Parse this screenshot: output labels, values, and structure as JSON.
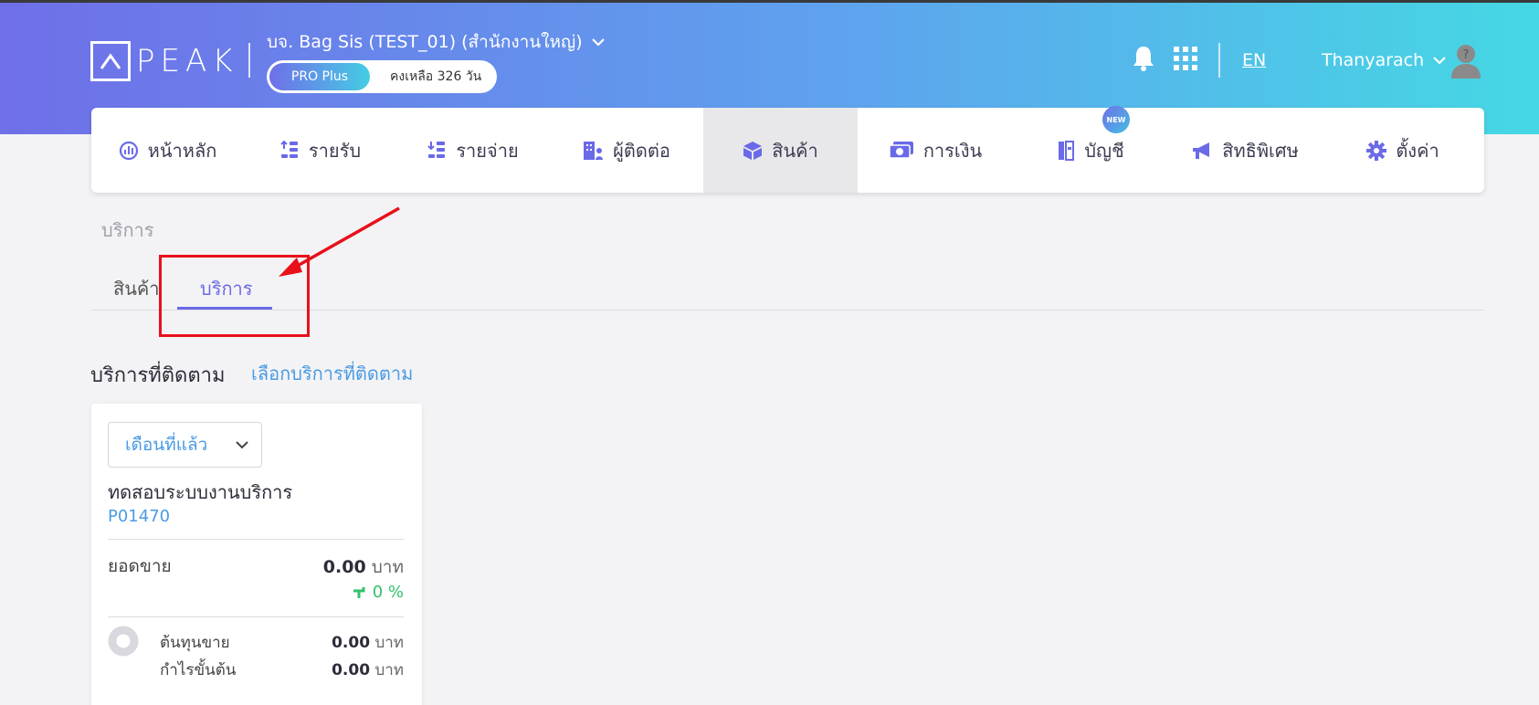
{
  "header": {
    "logo_text": "PEAK",
    "company": "บจ. Bag Sis (TEST_01) (สำนักงานใหญ่)",
    "plan_name": "PRO Plus",
    "plan_days": "คงเหลือ 326 วัน",
    "language": "EN",
    "username": "Thanyarach",
    "icons": [
      "bell-icon",
      "apps-grid-icon",
      "chevron-down-icon",
      "user-avatar-icon"
    ],
    "gradient": [
      "#6f6fe8",
      "#5ea3ee",
      "#45d8e4"
    ]
  },
  "nav": {
    "items": [
      {
        "label": "หน้าหลัก",
        "icon": "dashboard-icon"
      },
      {
        "label": "รายรับ",
        "icon": "income-icon"
      },
      {
        "label": "รายจ่าย",
        "icon": "expense-icon"
      },
      {
        "label": "ผู้ติดต่อ",
        "icon": "contacts-icon"
      },
      {
        "label": "สินค้า",
        "icon": "box-icon",
        "active": true
      },
      {
        "label": "การเงิน",
        "icon": "money-icon"
      },
      {
        "label": "บัญชี",
        "icon": "ledger-icon",
        "badge": "NEW"
      },
      {
        "label": "สิทธิพิเศษ",
        "icon": "megaphone-icon"
      },
      {
        "label": "ตั้งค่า",
        "icon": "gear-icon"
      }
    ]
  },
  "breadcrumb": "บริการ",
  "tabs": {
    "products": "สินค้า",
    "services": "บริการ",
    "active": "services"
  },
  "section": {
    "title": "บริการที่ติดตาม",
    "link": "เลือกบริการที่ติดตาม"
  },
  "card": {
    "period": "เดือนที่แล้ว",
    "service_name": "ทดสอบระบบงานบริการ",
    "service_code": "P01470",
    "sales_label": "ยอดขาย",
    "sales_value": "0.00",
    "currency": "บาท",
    "growth": "0 %",
    "cost_label": "ต้นทุนขาย",
    "cost_value": "0.00",
    "profit_label": "กำไรขั้นต้น",
    "profit_value": "0.00"
  },
  "colors": {
    "accent": "#6a6ae8",
    "link": "#4a9be4",
    "positive": "#33c06b",
    "annotation": "#e8101a"
  }
}
